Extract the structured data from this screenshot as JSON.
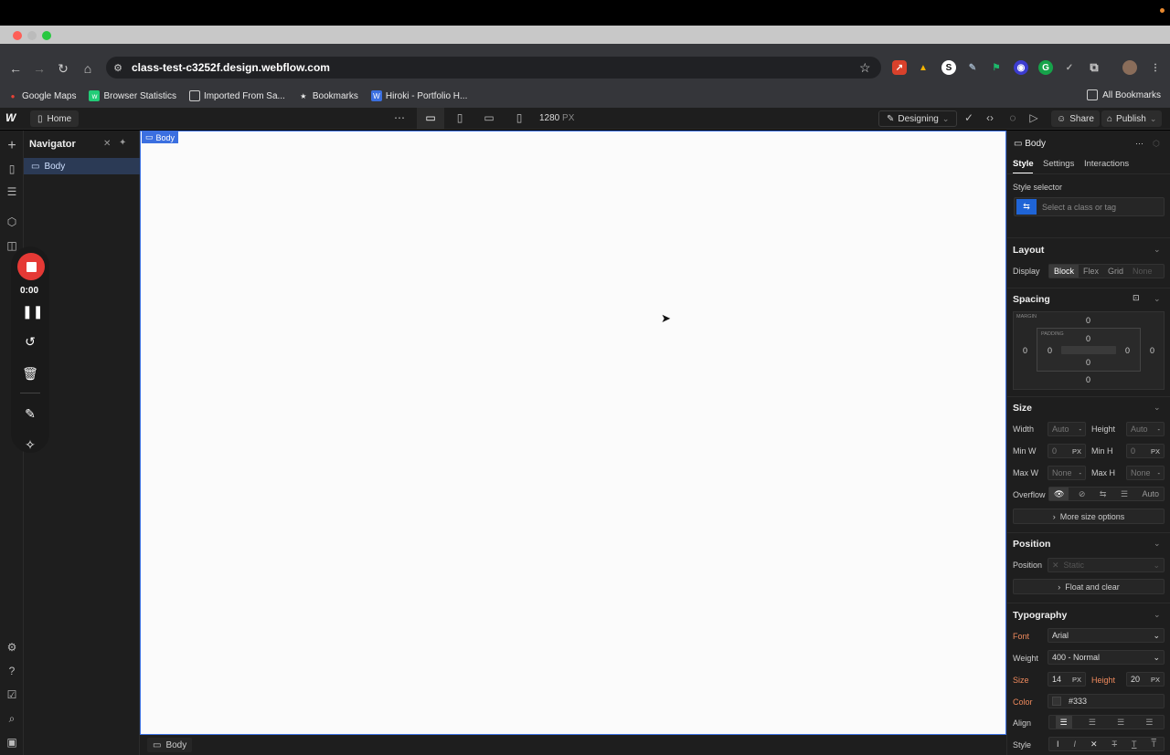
{
  "browser": {
    "url": "class-test-c3252f.design.webflow.com",
    "bookmarks": [
      "Google Maps",
      "Browser Statistics",
      "Imported From Sa...",
      "Bookmarks",
      "Hiroki - Portfolio H..."
    ],
    "all_bookmarks": "All Bookmarks"
  },
  "toolbar": {
    "home_label": "Home",
    "width_value": "1280",
    "width_unit": "PX",
    "mode_label": "Designing",
    "share_label": "Share",
    "publish_label": "Publish"
  },
  "navigator": {
    "title": "Navigator",
    "item": "Body"
  },
  "canvas": {
    "selected_tag": "Body",
    "breadcrumb": "Body"
  },
  "recorder": {
    "time": "0:00"
  },
  "panel": {
    "element": "Body",
    "tabs": [
      "Style",
      "Settings",
      "Interactions"
    ],
    "style_selector_label": "Style selector",
    "style_selector_placeholder": "Select a class or tag",
    "layout": {
      "title": "Layout",
      "display_label": "Display",
      "options": [
        "Block",
        "Flex",
        "Grid",
        "None"
      ]
    },
    "spacing": {
      "title": "Spacing",
      "margin_label": "MARGIN",
      "padding_label": "PADDING",
      "margin": {
        "top": "0",
        "right": "0",
        "bottom": "0",
        "left": "0"
      },
      "padding": {
        "top": "0",
        "right": "0",
        "bottom": "0",
        "left": "0"
      }
    },
    "size": {
      "title": "Size",
      "width_label": "Width",
      "width": "Auto",
      "height_label": "Height",
      "height": "Auto",
      "minw_label": "Min W",
      "minw": "0",
      "minh_label": "Min H",
      "minh": "0",
      "maxw_label": "Max W",
      "maxw": "None",
      "maxh_label": "Max H",
      "maxh": "None",
      "px": "PX",
      "overflow_label": "Overflow",
      "overflow_auto": "Auto",
      "more_options": "More size options"
    },
    "position": {
      "title": "Position",
      "label": "Position",
      "value": "Static",
      "float_clear": "Float and clear"
    },
    "typography": {
      "title": "Typography",
      "font_label": "Font",
      "font": "Arial",
      "weight_label": "Weight",
      "weight": "400 - Normal",
      "size_label": "Size",
      "size": "14",
      "height_label": "Height",
      "height": "20",
      "px": "PX",
      "color_label": "Color",
      "color": "#333",
      "align_label": "Align",
      "style_label": "Style"
    }
  }
}
